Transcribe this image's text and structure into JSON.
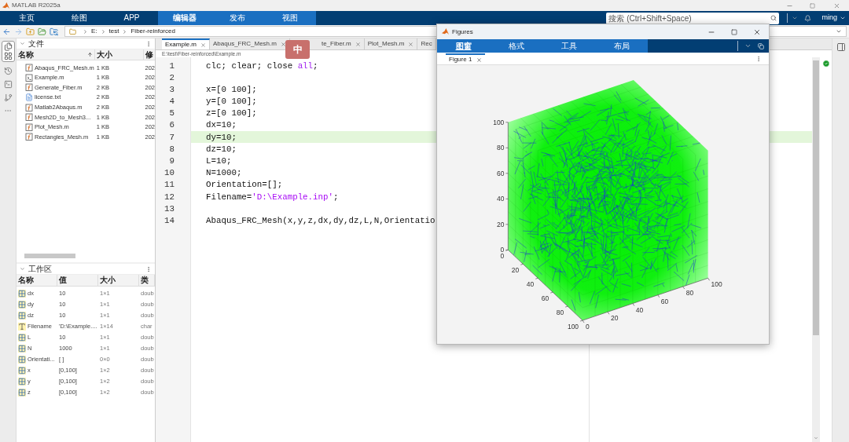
{
  "app": {
    "title": "MATLAB R2025a"
  },
  "ribbon": {
    "tabs": [
      {
        "label": "主页",
        "selected": false,
        "contextual": false
      },
      {
        "label": "绘图",
        "selected": false,
        "contextual": false
      },
      {
        "label": "APP",
        "selected": false,
        "contextual": false
      },
      {
        "label": "编辑器",
        "selected": true,
        "contextual": true
      },
      {
        "label": "发布",
        "selected": false,
        "contextual": true
      },
      {
        "label": "视图",
        "selected": false,
        "contextual": true
      }
    ],
    "search": {
      "placeholder": "搜索 (Ctrl+Shift+Space)"
    },
    "user": "ming"
  },
  "address": {
    "segments": [
      "E:",
      "test",
      "Fiber-reinforced"
    ]
  },
  "files": {
    "title": "文件",
    "columns": [
      "名称",
      "大小",
      "修"
    ],
    "rows": [
      {
        "name": "Abaqus_FRC_Mesh.m",
        "size": "1 KB",
        "modified": "202",
        "kind": "function"
      },
      {
        "name": "Example.m",
        "size": "1 KB",
        "modified": "202",
        "kind": "script"
      },
      {
        "name": "Generate_Fiber.m",
        "size": "2 KB",
        "modified": "202",
        "kind": "function"
      },
      {
        "name": "license.txt",
        "size": "2 KB",
        "modified": "202",
        "kind": "text"
      },
      {
        "name": "Matlab2Abaqus.m",
        "size": "2 KB",
        "modified": "202",
        "kind": "function"
      },
      {
        "name": "Mesh2D_to_Mesh3...",
        "size": "1 KB",
        "modified": "202",
        "kind": "function"
      },
      {
        "name": "Plot_Mesh.m",
        "size": "1 KB",
        "modified": "202",
        "kind": "function"
      },
      {
        "name": "Rectangles_Mesh.m",
        "size": "1 KB",
        "modified": "202",
        "kind": "function"
      }
    ]
  },
  "workspace": {
    "title": "工作区",
    "columns": [
      "名称",
      "值",
      "大小",
      "类"
    ],
    "rows": [
      {
        "name": "dx",
        "value": "10",
        "size": "1×1",
        "class": "doub",
        "kind": "matrix"
      },
      {
        "name": "dy",
        "value": "10",
        "size": "1×1",
        "class": "doub",
        "kind": "matrix"
      },
      {
        "name": "dz",
        "value": "10",
        "size": "1×1",
        "class": "doub",
        "kind": "matrix"
      },
      {
        "name": "Filename",
        "value": "'D:\\Example....",
        "size": "1×14",
        "class": "char",
        "kind": "char"
      },
      {
        "name": "L",
        "value": "10",
        "size": "1×1",
        "class": "doub",
        "kind": "matrix"
      },
      {
        "name": "N",
        "value": "1000",
        "size": "1×1",
        "class": "doub",
        "kind": "matrix"
      },
      {
        "name": "Orientati...",
        "value": "[ ]",
        "size": "0×0",
        "class": "doub",
        "kind": "matrix"
      },
      {
        "name": "x",
        "value": "[0,100]",
        "size": "1×2",
        "class": "doub",
        "kind": "matrix"
      },
      {
        "name": "y",
        "value": "[0,100]",
        "size": "1×2",
        "class": "doub",
        "kind": "matrix"
      },
      {
        "name": "z",
        "value": "[0,100]",
        "size": "1×2",
        "class": "doub",
        "kind": "matrix"
      }
    ]
  },
  "editor": {
    "tabs": [
      {
        "label": "Example.m",
        "selected": true
      },
      {
        "label": "Abaqus_FRC_Mesh.m",
        "selected": false
      },
      {
        "label": "te_Fiber.m",
        "selected": false
      },
      {
        "label": "Plot_Mesh.m",
        "selected": false
      },
      {
        "label": "Rec",
        "selected": false
      }
    ],
    "path": "E:\\test\\Fiber-reinforced\\Example.m",
    "lines": [
      {
        "number": "1",
        "current": false,
        "segments": [
          {
            "text": "clc; clear; close ",
            "kind": "plain"
          },
          {
            "text": "all",
            "kind": "keyword"
          },
          {
            "text": ";",
            "kind": "plain"
          }
        ]
      },
      {
        "number": "2",
        "current": false
      },
      {
        "number": "3",
        "current": false,
        "segments": [
          {
            "text": "x=[0 100];",
            "kind": "plain"
          }
        ]
      },
      {
        "number": "4",
        "current": false,
        "segments": [
          {
            "text": "y=[0 100];",
            "kind": "plain"
          }
        ]
      },
      {
        "number": "5",
        "current": false,
        "segments": [
          {
            "text": "z=[0 100];",
            "kind": "plain"
          }
        ]
      },
      {
        "number": "6",
        "current": false,
        "segments": [
          {
            "text": "dx=10;",
            "kind": "plain"
          }
        ]
      },
      {
        "number": "7",
        "current": true,
        "segments": [
          {
            "text": "dy=10;",
            "kind": "plain"
          }
        ]
      },
      {
        "number": "8",
        "current": false,
        "segments": [
          {
            "text": "dz=10;",
            "kind": "plain"
          }
        ]
      },
      {
        "number": "9",
        "current": false,
        "segments": [
          {
            "text": "L=10;",
            "kind": "plain"
          }
        ]
      },
      {
        "number": "10",
        "current": false,
        "segments": [
          {
            "text": "N=1000;",
            "kind": "plain"
          }
        ]
      },
      {
        "number": "11",
        "current": false,
        "segments": [
          {
            "text": "Orientation=[];",
            "kind": "plain"
          }
        ]
      },
      {
        "number": "12",
        "current": false,
        "segments": [
          {
            "text": "Filename=",
            "kind": "plain"
          },
          {
            "text": "'D:\\Example.inp'",
            "kind": "string"
          },
          {
            "text": ";",
            "kind": "plain"
          }
        ]
      },
      {
        "number": "13",
        "current": false
      },
      {
        "number": "14",
        "current": false,
        "segments": [
          {
            "text": "Abaqus_FRC_Mesh(x,y,z,dx,dy,dz,L,N,Orientatio",
            "kind": "plain"
          }
        ]
      }
    ]
  },
  "ime": {
    "label": "中"
  },
  "figure_window": {
    "title": "Figures",
    "tabs": [
      {
        "label": "图窗",
        "selected": true
      },
      {
        "label": "格式",
        "selected": false
      },
      {
        "label": "工具",
        "selected": false
      },
      {
        "label": "布局",
        "selected": false
      }
    ],
    "doc_tabs": [
      {
        "label": "Figure 1",
        "selected": true
      }
    ],
    "axes": {
      "z_ticks": [
        "100",
        "80",
        "60",
        "40",
        "20",
        "0"
      ],
      "y_ticks": [
        "0",
        "20",
        "40",
        "60",
        "80",
        "100"
      ],
      "x_ticks": [
        "0",
        "20",
        "40",
        "60",
        "80",
        "100"
      ]
    }
  }
}
